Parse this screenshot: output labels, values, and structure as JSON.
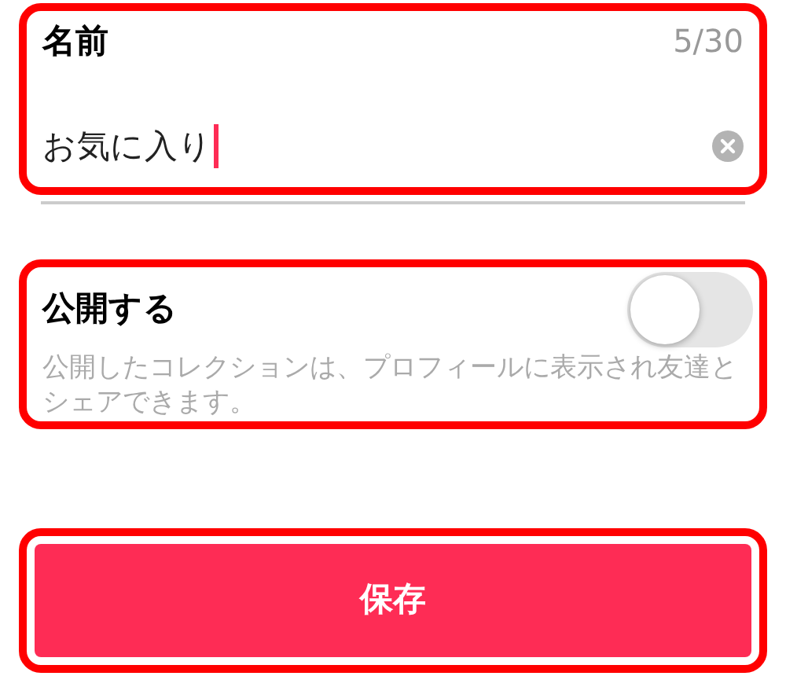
{
  "name_field": {
    "label": "名前",
    "counter": "5/30",
    "value": "お気に入り",
    "focused": true
  },
  "public_setting": {
    "label": "公開する",
    "on": false,
    "description": "公開したコレクションは、プロフィールに表示され友達とシェアできます。"
  },
  "save_button": {
    "label": "保存"
  }
}
